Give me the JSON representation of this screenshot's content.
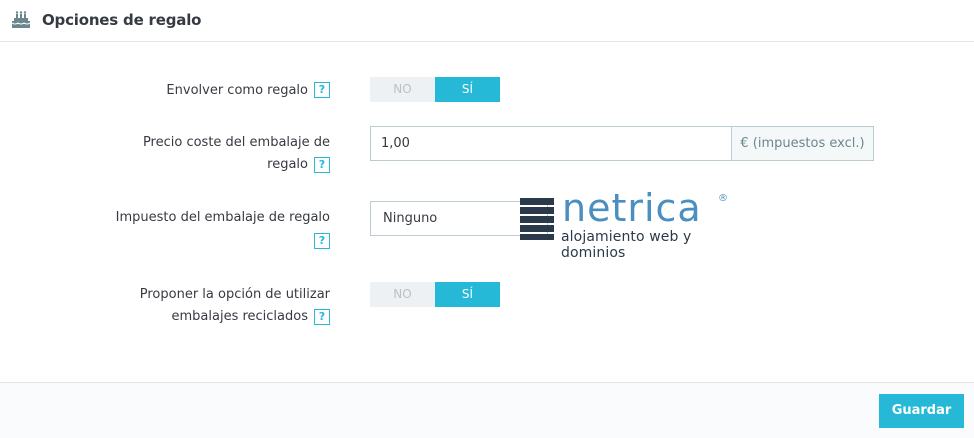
{
  "header": {
    "title": "Opciones de regalo",
    "icon": "gift-cake-icon"
  },
  "fields": {
    "wrap": {
      "label": "Envolver como regalo",
      "help": "?",
      "no": "NO",
      "yes": "SÍ",
      "selected": "SÍ"
    },
    "price": {
      "label_line1": "Precio coste del embalaje de",
      "label_line2": "regalo",
      "help": "?",
      "value": "1,00",
      "addon": "€ (impuestos excl.)"
    },
    "tax": {
      "label": "Impuesto del embalaje de regalo",
      "help": "?",
      "value": "Ninguno"
    },
    "recycled": {
      "label_line1": "Proponer la opción de utilizar",
      "label_line2": "embalajes reciclados",
      "help": "?",
      "no": "NO",
      "yes": "SÍ",
      "selected": "SÍ"
    }
  },
  "watermark": {
    "name": "netrica",
    "registered": "®",
    "tagline": "alojamiento web y dominios"
  },
  "footer": {
    "save_label": "Guardar"
  },
  "colors": {
    "accent": "#25b9d7",
    "text": "#363a41",
    "muted": "#b9c1c7",
    "logo_blue": "#4a8fc0",
    "logo_dark": "#2b3a4b"
  }
}
